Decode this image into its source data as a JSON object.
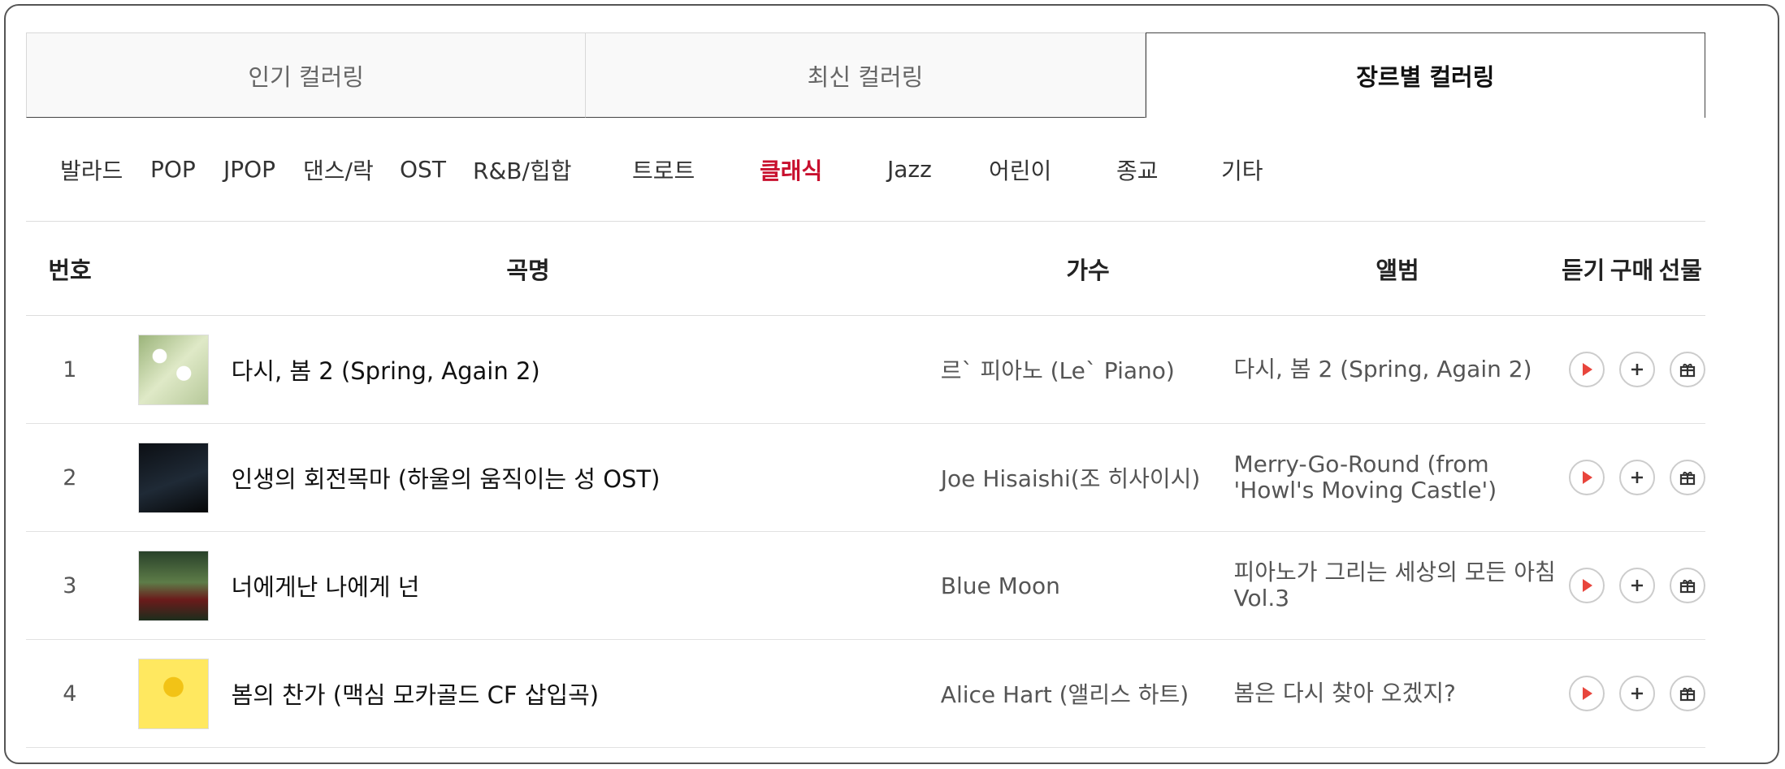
{
  "tabs": [
    {
      "label": "인기 컬러링",
      "active": false
    },
    {
      "label": "최신 컬러링",
      "active": false
    },
    {
      "label": "장르별 컬러링",
      "active": true
    }
  ],
  "genres": [
    "발라드",
    "POP",
    "JPOP",
    "댄스/락",
    "OST",
    "R&B/힙합",
    "트로트",
    "클래식",
    "Jazz",
    "어린이",
    "종교",
    "기타"
  ],
  "active_genre": "클래식",
  "table": {
    "headers": {
      "num": "번호",
      "title": "곡명",
      "artist": "가수",
      "album": "앨범",
      "listen": "듣기",
      "buy": "구매",
      "gift": "선물"
    },
    "rows": [
      {
        "num": "1",
        "title": "다시, 봄 2 (Spring, Again 2)",
        "artist": "르` 피아노 (Le` Piano)",
        "album": "다시, 봄 2 (Spring, Again 2)"
      },
      {
        "num": "2",
        "title": "인생의 회전목마 (하울의 움직이는 성 OST)",
        "artist": "Joe Hisaishi(조 히사이시)",
        "album": "Merry-Go-Round (from 'Howl's Moving Castle')"
      },
      {
        "num": "3",
        "title": "너에게난 나에게 넌",
        "artist": "Blue Moon",
        "album": "피아노가 그리는 세상의 모든 아침 Vol.3"
      },
      {
        "num": "4",
        "title": "봄의 찬가 (맥심 모카골드 CF 삽입곡)",
        "artist": "Alice Hart (앨리스 하트)",
        "album": "봄은 다시 찾아 오겠지?"
      }
    ]
  },
  "icons": {
    "play": "play-icon",
    "add": "plus-icon",
    "gift": "gift-icon"
  },
  "colors": {
    "accent": "#c8102e",
    "play": "#e8453c"
  }
}
